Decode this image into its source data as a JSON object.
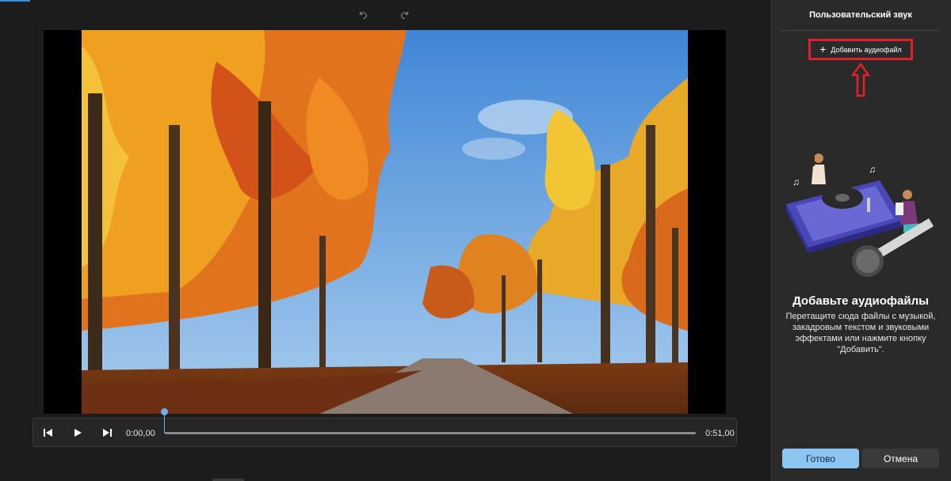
{
  "toolbar": {
    "undo_icon": "undo-icon",
    "redo_icon": "redo-icon"
  },
  "player": {
    "current_time": "0:00,00",
    "duration": "0:51,00",
    "progress": 0,
    "icons": [
      "skip-back-icon",
      "play-icon",
      "skip-forward-icon"
    ]
  },
  "panel": {
    "title": "Пользовательский звук",
    "add_button_label": "Добавить аудиофайл",
    "empty_title": "Добавьте аудиофайлы",
    "empty_description": "Перетащите сюда файлы с музыкой, закадровым текстом и звуковыми эффектами или нажмите кнопку \"Добавить\".",
    "done_label": "Готово",
    "cancel_label": "Отмена"
  },
  "colors": {
    "accent": "#8cc4f2",
    "annotation_red": "#e0202a",
    "panel_bg": "#2a2a2a",
    "app_bg": "#1c1c1c"
  }
}
